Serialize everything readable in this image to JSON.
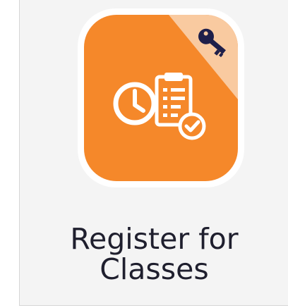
{
  "tile": {
    "title_line1": "Register for",
    "title_line2": "Classes",
    "icons": [
      "clock-icon",
      "clipboard-icon",
      "checkmark-icon",
      "key-icon"
    ],
    "colors": {
      "accent": "#f5882a",
      "corner": "#f9caa0",
      "key": "#1f1f4a",
      "background": "#f4f4f4",
      "text": "#1f1f2e"
    }
  }
}
